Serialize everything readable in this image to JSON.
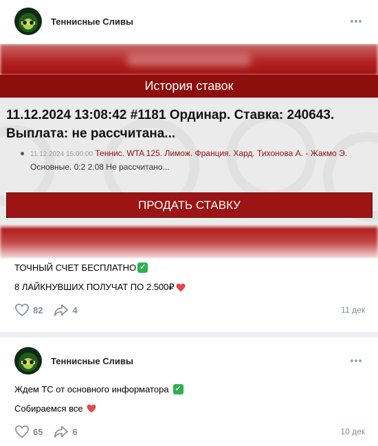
{
  "posts": [
    {
      "author": "Теннисные Сливы",
      "image": {
        "header": "История ставок",
        "bet_title": "11.12.2024 13:08:42 #1181 Ординар. Ставка: 240643. Выплата: не рассчитана...",
        "item_date": "11.12.2024 15:00:00",
        "item_event": "Теннис. WTA 125. Лимож. Франция. Хард. Тихонова А. - Жакмо Э.",
        "item_status": "Основные. 0:2 2.08 Не рассчитано...",
        "sell_button": "ПРОДАТЬ СТАВКУ"
      },
      "lines": [
        "ТОЧНЫЙ СЧЕТ БЕСПЛАТНО",
        "8 ЛАЙКНУВШИХ ПОЛУЧАТ ПО 2.500₽"
      ],
      "likes": "82",
      "shares": "4",
      "date": "11 дек"
    },
    {
      "author": "Теннисные Сливы",
      "lines": [
        "Ждем ТС от основного информатора",
        "Собираемся все"
      ],
      "likes": "65",
      "shares": "6",
      "date": "10 дек"
    }
  ],
  "colors": {
    "accent_red": "#8e0d0d",
    "check_green": "#2bb24c",
    "heart_red": "#e64646",
    "meta_gray": "#818c99"
  }
}
